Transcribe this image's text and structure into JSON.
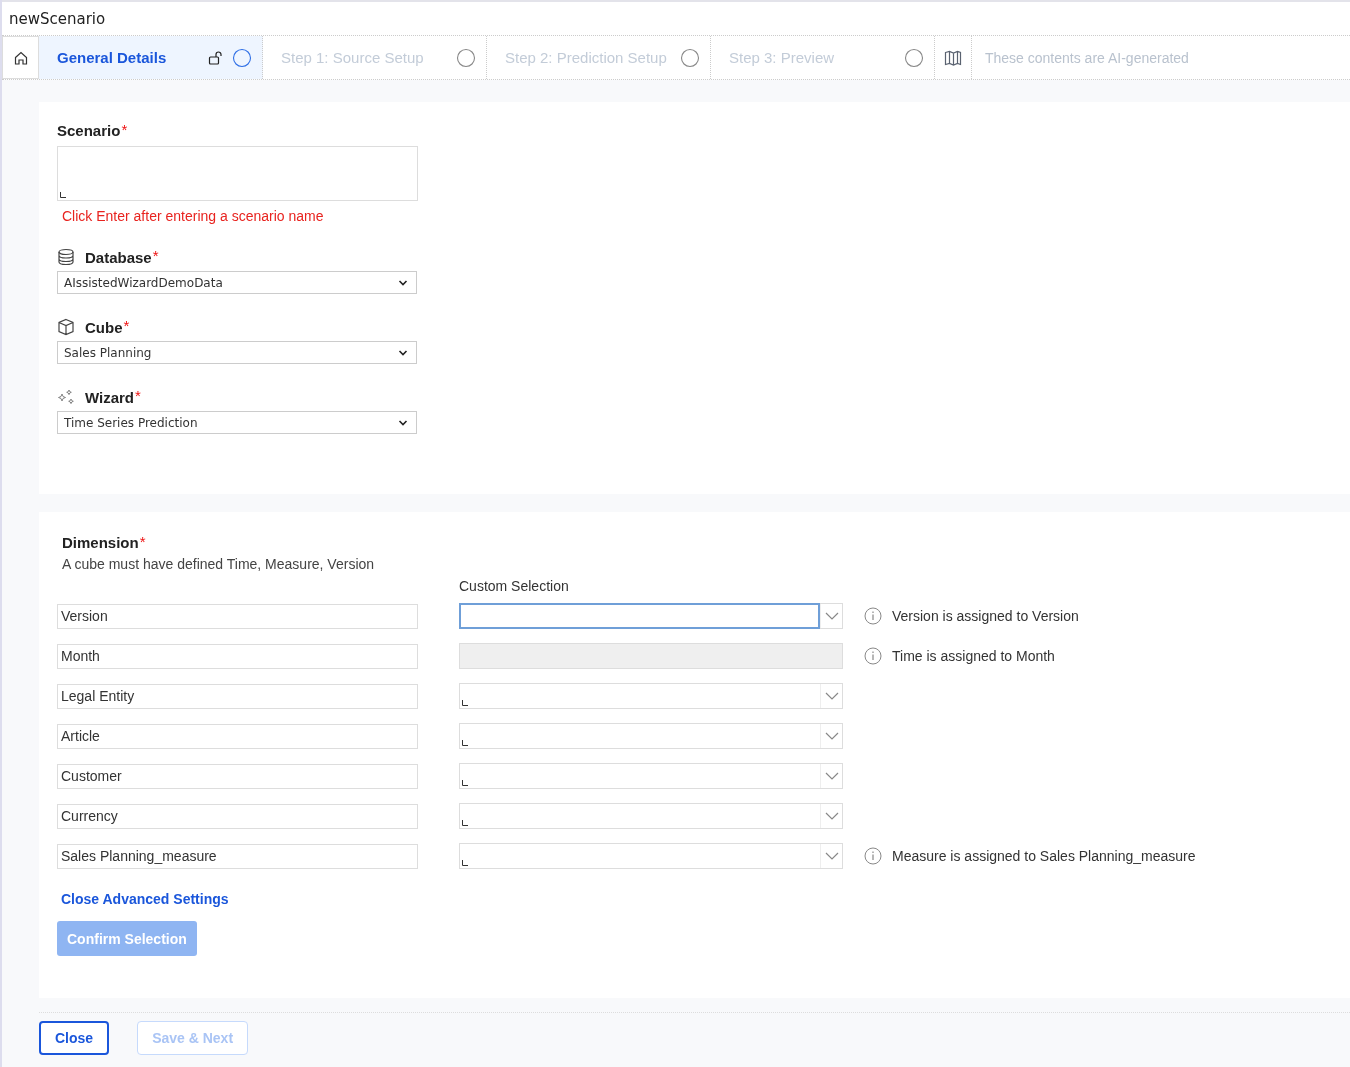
{
  "window": {
    "title": "newScenario"
  },
  "tabs": [
    {
      "label": "General Details",
      "selected": true,
      "locked": true
    },
    {
      "label": "Step 1: Source Setup",
      "selected": false,
      "locked": false
    },
    {
      "label": "Step 2: Prediction Setup",
      "selected": false,
      "locked": false
    },
    {
      "label": "Step 3: Preview",
      "selected": false,
      "locked": false
    }
  ],
  "ai_notice": "These contents are AI-generated",
  "general": {
    "scenario": {
      "label": "Scenario",
      "required_mark": "*",
      "hint": "Click Enter after entering a scenario name"
    },
    "fields": [
      {
        "kind": "database",
        "label": "Database",
        "required_mark": "*",
        "value": "AIssistedWizardDemoData"
      },
      {
        "kind": "cube",
        "label": "Cube",
        "required_mark": "*",
        "value": "Sales Planning"
      },
      {
        "kind": "wizard",
        "label": "Wizard",
        "required_mark": "*",
        "value": "Time Series Prediction"
      }
    ]
  },
  "dimension": {
    "title": "Dimension",
    "required_mark": "*",
    "description": "A cube must have defined Time, Measure, Version",
    "selection_header": "Custom Selection",
    "rows": [
      {
        "name": "Version",
        "kind": "focused",
        "note": "Version is assigned to Version"
      },
      {
        "name": "Month",
        "kind": "disabled",
        "note": "Time is assigned to Month"
      },
      {
        "name": "Legal Entity",
        "kind": "select"
      },
      {
        "name": "Article",
        "kind": "select"
      },
      {
        "name": "Customer",
        "kind": "select"
      },
      {
        "name": "Currency",
        "kind": "select"
      },
      {
        "name": "Sales Planning_measure",
        "kind": "select",
        "note": "Measure is assigned to Sales Planning_measure"
      }
    ],
    "advanced_link": "Close Advanced Settings",
    "confirm": {
      "label": "Confirm Selection",
      "disabled": true
    }
  },
  "footer": {
    "close": "Close",
    "save": {
      "label": "Save & Next",
      "disabled": true
    }
  }
}
